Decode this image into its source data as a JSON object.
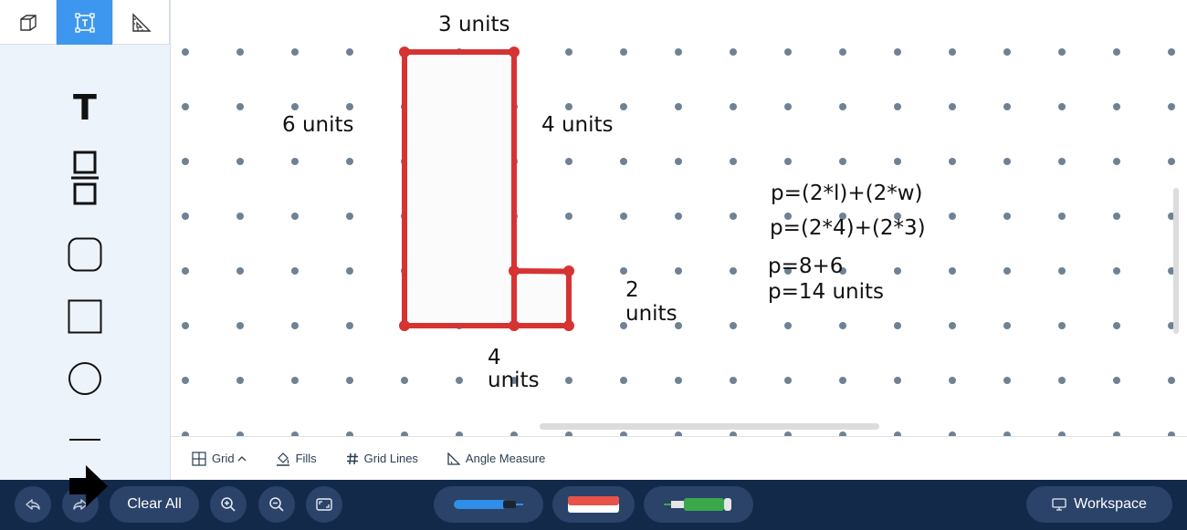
{
  "mode_tabs": [
    {
      "id": "3d",
      "icon": "cube-icon",
      "active": false
    },
    {
      "id": "text",
      "icon": "text-box-icon",
      "active": true
    },
    {
      "id": "measure",
      "icon": "set-square-ruler-icon",
      "active": false
    }
  ],
  "palette": {
    "text_tool_glyph": "T",
    "items": [
      "text-tool-icon",
      "fraction-icon",
      "rounded-square-icon",
      "square-icon",
      "circle-icon",
      "line-icon"
    ]
  },
  "canvas": {
    "shape_color": "#d63333",
    "dot_color": "#6f8294",
    "labels": {
      "top": "3 units",
      "left": "6 units",
      "right": "4 units",
      "small_side_line1": "2",
      "small_side_line2": "units",
      "bottom_line1": "4",
      "bottom_line2": "units"
    },
    "work": {
      "line1": "p=(2*l)+(2*w)",
      "line2": "p=(2*4)+(2*3)",
      "line3": "p=8+6",
      "line4": "p=14 units"
    }
  },
  "options_bar": {
    "grid": "Grid",
    "fills": "Fills",
    "grid_lines": "Grid Lines",
    "angle_measure": "Angle Measure"
  },
  "toolbar": {
    "clear_all": "Clear All",
    "workspace": "Workspace",
    "pens": [
      {
        "name": "blue-marker",
        "color": "#2f8ee8"
      },
      {
        "name": "red-eraser",
        "color": "#e8524a"
      },
      {
        "name": "green-marker",
        "color": "#3aa84a"
      }
    ]
  }
}
